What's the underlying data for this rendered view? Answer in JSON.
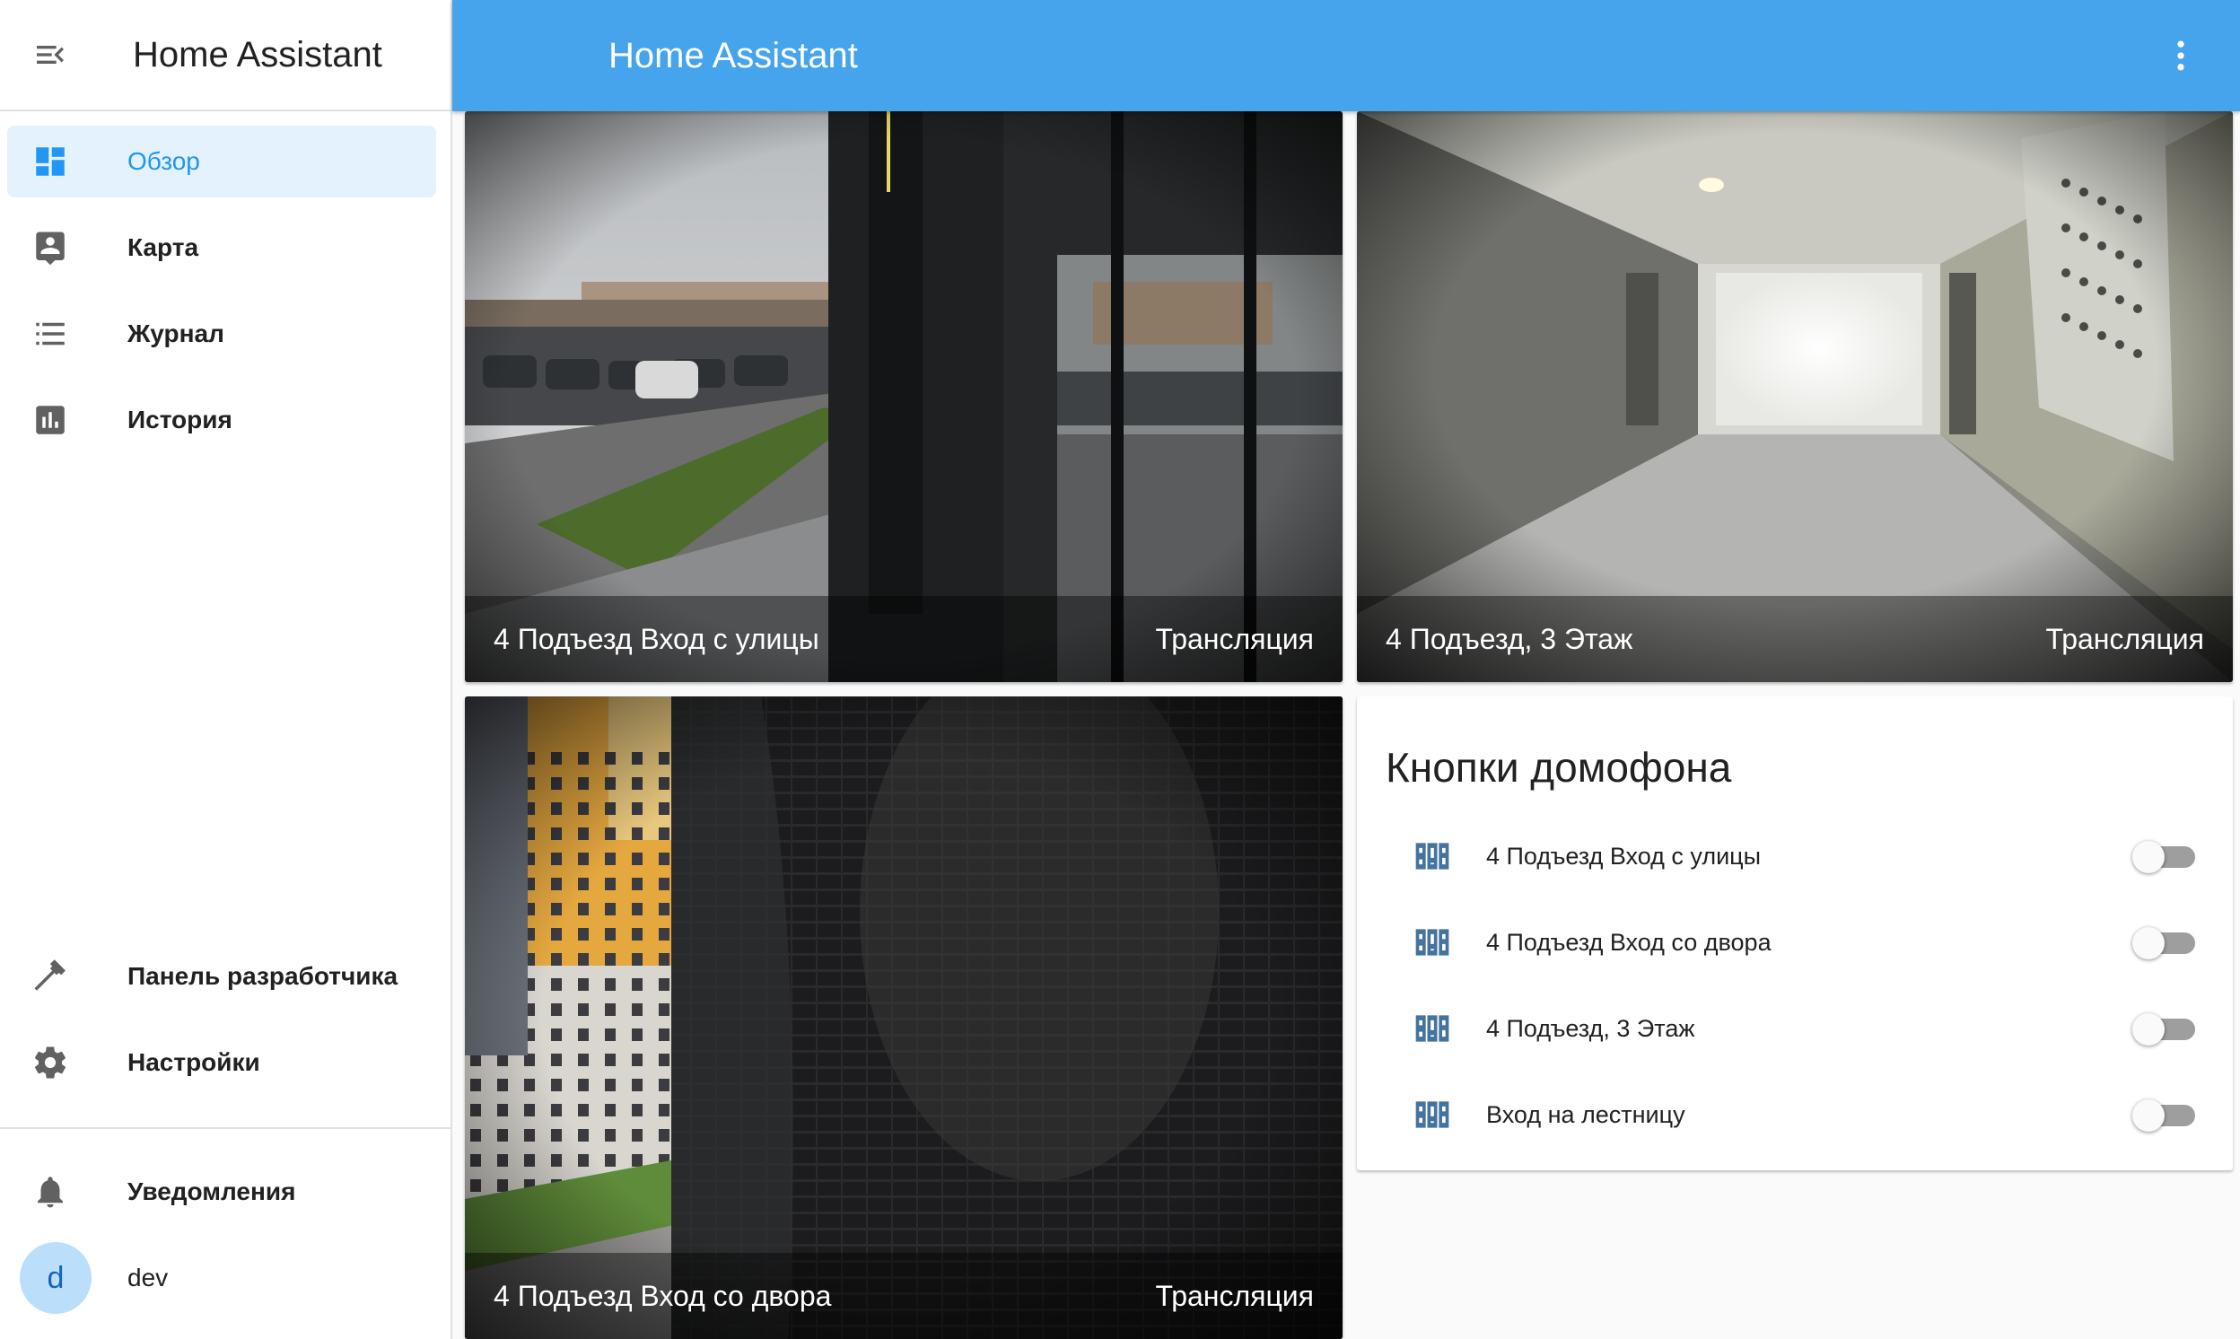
{
  "sidebar": {
    "title": "Home Assistant",
    "items": [
      {
        "label": "Обзор",
        "icon": "dashboard-icon",
        "active": true
      },
      {
        "label": "Карта",
        "icon": "map-account-icon"
      },
      {
        "label": "Журнал",
        "icon": "list-icon"
      },
      {
        "label": "История",
        "icon": "chart-icon"
      }
    ],
    "bottom_items": [
      {
        "label": "Панель разработчика",
        "icon": "hammer-icon"
      },
      {
        "label": "Настройки",
        "icon": "gear-icon"
      }
    ],
    "notifications_label": "Уведомления",
    "user": {
      "initial": "d",
      "name": "dev"
    }
  },
  "topbar": {
    "title": "Home Assistant"
  },
  "cameras": [
    {
      "name": "4 Подъезд Вход с улицы",
      "action": "Трансляция"
    },
    {
      "name": "4 Подъезд, 3 Этаж",
      "action": "Трансляция"
    },
    {
      "name": "4 Подъезд Вход со двора",
      "action": "Трансляция"
    }
  ],
  "intercom": {
    "title": "Кнопки домофона",
    "buttons": [
      {
        "label": "4 Подъезд Вход с улицы",
        "on": false
      },
      {
        "label": "4 Подъезд Вход со двора",
        "on": false
      },
      {
        "label": "4 Подъезд, 3 Этаж",
        "on": false
      },
      {
        "label": "Вход на лестницу",
        "on": false
      }
    ]
  },
  "colors": {
    "accent": "#45a4ec",
    "active_bg": "#e3f2fd",
    "active_text": "#2196f3",
    "icon_gray": "#616161",
    "intercom_icon": "#44739e"
  }
}
